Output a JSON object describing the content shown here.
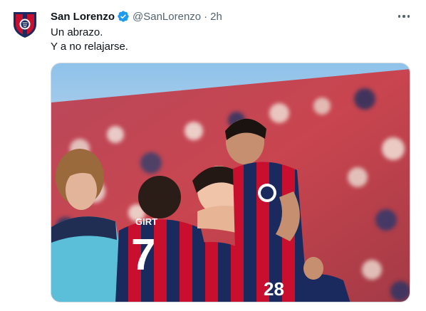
{
  "tweet": {
    "author_name": "San Lorenzo",
    "handle": "@SanLorenzo",
    "separator": "·",
    "time": "2h",
    "lines": [
      "Un abrazo.",
      "Y a no relajarse."
    ],
    "verified_icon": "verified-badge-icon",
    "more_icon": "more-options-icon"
  },
  "photo": {
    "jersey_name": "GIRT",
    "jersey_number_left": "7",
    "jersey_number_right": "28",
    "colors": {
      "red": "#c8102e",
      "navy": "#1b2a5e",
      "sky": "#7fb8e6"
    }
  }
}
